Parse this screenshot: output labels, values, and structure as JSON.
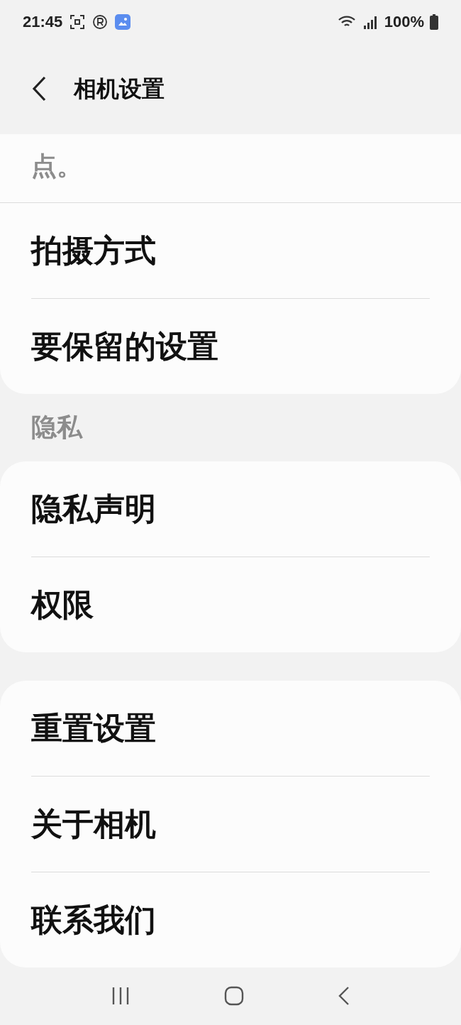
{
  "status_bar": {
    "time": "21:45",
    "battery": "100%"
  },
  "header": {
    "title": "相机设置"
  },
  "groups": [
    {
      "partial_text": "点。",
      "items": [
        {
          "label": "拍摄方式"
        },
        {
          "label": "要保留的设置"
        }
      ]
    },
    {
      "section": "隐私",
      "items": [
        {
          "label": "隐私声明"
        },
        {
          "label": "权限"
        }
      ]
    },
    {
      "items": [
        {
          "label": "重置设置"
        },
        {
          "label": "关于相机"
        },
        {
          "label": "联系我们"
        }
      ]
    }
  ]
}
